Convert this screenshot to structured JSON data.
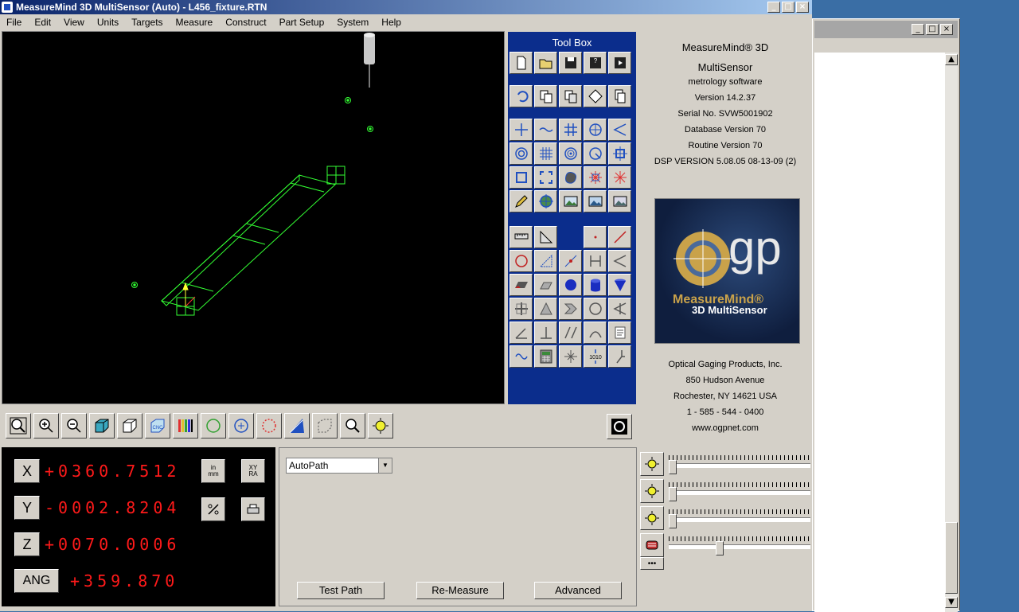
{
  "window": {
    "title": "MeasureMind 3D MultiSensor (Auto)  - L456_fixture.RTN",
    "caption_buttons": [
      "_",
      "□",
      "×"
    ]
  },
  "menu": [
    "File",
    "Edit",
    "View",
    "Units",
    "Targets",
    "Measure",
    "Construct",
    "Part Setup",
    "System",
    "Help"
  ],
  "toolbox": {
    "title": "Tool Box",
    "file_tools": [
      "new-icon",
      "open-icon",
      "save-icon",
      "save-as-icon",
      "save-all-icon"
    ],
    "edit_tools": [
      "undo-icon",
      "copy-icon",
      "paste-icon",
      "transform-icon",
      "duplicate-icon"
    ],
    "target_tools": [
      "crosshair-icon",
      "edge-trace-icon",
      "grid-icon",
      "circle-crosshair-icon",
      "angle-icon",
      "concentric-icon",
      "grid-dense-icon",
      "bullseye-icon",
      "circle-angle-icon",
      "square-cross-icon",
      "square-icon",
      "corners-icon",
      "blob-icon",
      "burst-red-icon",
      "star-red-icon",
      "pencil-icon",
      "target-sensor-icon",
      "image-icon",
      "image-alt-icon",
      "image-third-icon"
    ],
    "measure_tools": [
      "ruler-icon",
      "angle-ruler-icon",
      "",
      "point-icon",
      "line-icon",
      "circle-icon",
      "triangle-icon",
      "line-points-icon",
      "width-icon",
      "angle-feature-icon",
      "plane-icon",
      "surface-icon",
      "sphere-icon",
      "cylinder-icon",
      "cone-icon",
      "quadrant-icon",
      "intersect-icon",
      "chevron-icon",
      "circle-outline-icon",
      "taper-icon",
      "angle-between-icon",
      "perpendicular-icon",
      "parallel-icon",
      "arc-icon",
      "notes-icon",
      "curve-icon",
      "calculator-icon",
      "datum-icon",
      "binary-output-icon",
      "probe-icon"
    ]
  },
  "about": {
    "product_line1": "MeasureMind® 3D",
    "product_line2": "MultiSensor",
    "tagline": "metrology software",
    "version": "Version 14.2.37",
    "serial": "Serial No.  SVW5001902",
    "database": "Database Version 70",
    "routine": "Routine Version 70",
    "dsp": "DSP VERSION 5.08.05 08-13-09 (2)",
    "logo_text": "gp",
    "logo_brand": "MeasureMind®",
    "logo_sub": "3D MultiSensor",
    "company": "Optical Gaging Products, Inc.",
    "street": "850 Hudson Avenue",
    "city": "Rochester, NY 14621 USA",
    "phone": "1 - 585 - 544 - 0400",
    "web": "www.ogpnet.com"
  },
  "view_tools": [
    "zoom-fit-icon",
    "zoom-in-icon",
    "zoom-out-icon",
    "iso-view-icon",
    "box-view-icon",
    "cnc-view-icon",
    "color-bars-icon",
    "fov-circle-icon",
    "fov-cross-icon",
    "fov-dashed-icon",
    "angle-tool-icon",
    "dashed-box-icon",
    "search-icon",
    "light-bulb-icon"
  ],
  "dro": {
    "x_label": "X",
    "x_value": "+0360.7512",
    "y_label": "Y",
    "y_value": "-0002.8204",
    "z_label": "Z",
    "z_value": "+0070.0006",
    "ang_label": "ANG",
    "ang_value": "+359.870",
    "units_btn_top": "in",
    "units_btn_bottom": "mm",
    "coord_btn_top": "XY",
    "coord_btn_bottom": "RA"
  },
  "path_panel": {
    "select_value": "AutoPath",
    "test_path": "Test Path",
    "remeasure": "Re-Measure",
    "advanced": "Advanced"
  },
  "lights": {
    "more_label": "•••",
    "levels": [
      0.0,
      0.0,
      0.0,
      0.35
    ]
  },
  "colors": {
    "toolbox_bg": "#0b2d8c",
    "dro_text": "#ff1a1a",
    "wireframe": "#33ff33",
    "logo_gold": "#c9a24a"
  }
}
